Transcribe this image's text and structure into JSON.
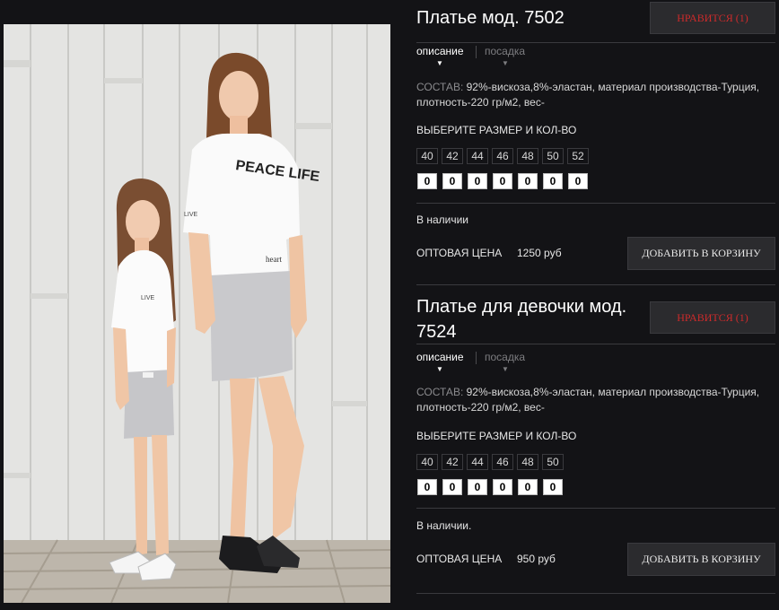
{
  "products": [
    {
      "title": "Платье мод. 7502",
      "like_label": "НРАВИТСЯ (1)",
      "tabs": [
        {
          "label": "описание",
          "active": true
        },
        {
          "label": "посадка",
          "active": false
        }
      ],
      "composition_label": "СОСТАВ:",
      "composition_text": " 92%-вискоза,8%-эластан, материал производства-Турция, плотность-220 гр/м2, вес-",
      "size_title": "ВЫБЕРИТЕ РАЗМЕР И КОЛ-ВО",
      "sizes": [
        "40",
        "42",
        "44",
        "46",
        "48",
        "50",
        "52"
      ],
      "quantities": [
        "0",
        "0",
        "0",
        "0",
        "0",
        "0",
        "0"
      ],
      "stock": "В наличии",
      "price_label": "ОПТОВАЯ ЦЕНА",
      "price": "1250 руб",
      "cart_label": "ДОБАВИТЬ В КОРЗИНУ"
    },
    {
      "title": "Платье для девочки мод. 7524",
      "like_label": "НРАВИТСЯ (1)",
      "tabs": [
        {
          "label": "описание",
          "active": true
        },
        {
          "label": "посадка",
          "active": false
        }
      ],
      "composition_label": "СОСТАВ:",
      "composition_text": " 92%-вискоза,8%-эластан, материал производства-Турция, плотность-220 гр/м2, вес-",
      "size_title": "ВЫБЕРИТЕ РАЗМЕР И КОЛ-ВО",
      "sizes": [
        "40",
        "42",
        "44",
        "46",
        "48",
        "50"
      ],
      "quantities": [
        "0",
        "0",
        "0",
        "0",
        "0",
        "0"
      ],
      "stock": "В наличии.",
      "price_label": "ОПТОВАЯ ЦЕНА",
      "price": "950 руб",
      "cart_label": "ДОБАВИТЬ В КОРЗИНУ"
    }
  ],
  "photo": {
    "shirt_print_main": "PEACE LIFE",
    "shirt_print_hem": "heart",
    "sleeve_print": "LIVE"
  },
  "colors": {
    "background": "#131316",
    "like_text": "#cc2b2b",
    "button_bg": "#2b2b2e"
  }
}
